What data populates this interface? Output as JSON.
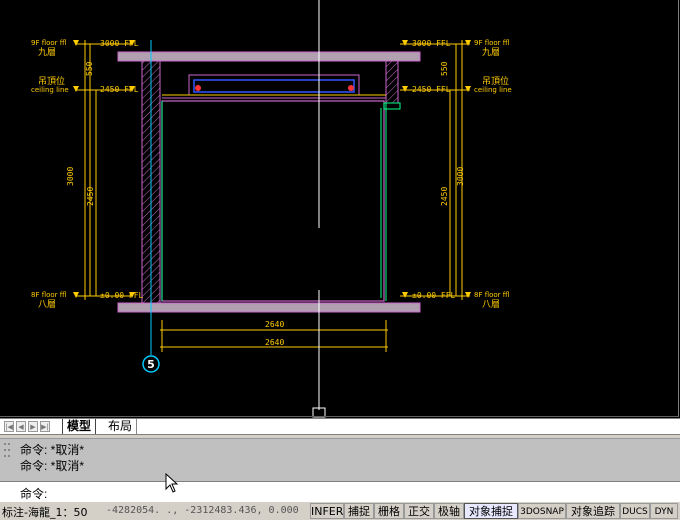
{
  "drawing": {
    "left_levels": [
      "3000 FFL",
      "2450 FFL",
      "±0.00 FFL"
    ],
    "right_levels": [
      "3000 FFL",
      "2450 FFL",
      "±0.00 FFL"
    ],
    "floor_labels": {
      "top_en": "9F floor ffl",
      "top_cn": "九層",
      "ceiling_cn": "吊頂位",
      "ceiling_en": "ceiling line",
      "bottom_en": "8F floor ffl",
      "bottom_cn": "八層"
    },
    "dims_left": [
      "550",
      "3000",
      "2450"
    ],
    "dims_right": [
      "550",
      "3000",
      "2450"
    ],
    "dims_bottom": [
      "2640",
      "2640"
    ],
    "grid_marker": "5",
    "colors": {
      "wall": "#cc66cc",
      "slab": "#b0a0b0",
      "dimension": "#ffcc00",
      "finish_line": "#00ff88",
      "ceiling": "#3355ff",
      "marker": "#ff3333",
      "grid": "#00ccff",
      "crosshair": "#ffffff"
    }
  },
  "tabs": {
    "model": "模型",
    "layout": "布局"
  },
  "command_history": [
    "命令: *取消*",
    "命令: *取消*"
  ],
  "command_prompt": "命令:",
  "status": {
    "left": "标注-海龍_1：50",
    "coords": "-4282054.   ., -2312483.436, 0.000",
    "buttons": [
      "INFER",
      "捕捉",
      "栅格",
      "正交",
      "极轴",
      "对象捕捉",
      "3DOSNAP",
      "对象追踪",
      "DUCS",
      "DYN"
    ],
    "active_button": "对象捕捉"
  }
}
